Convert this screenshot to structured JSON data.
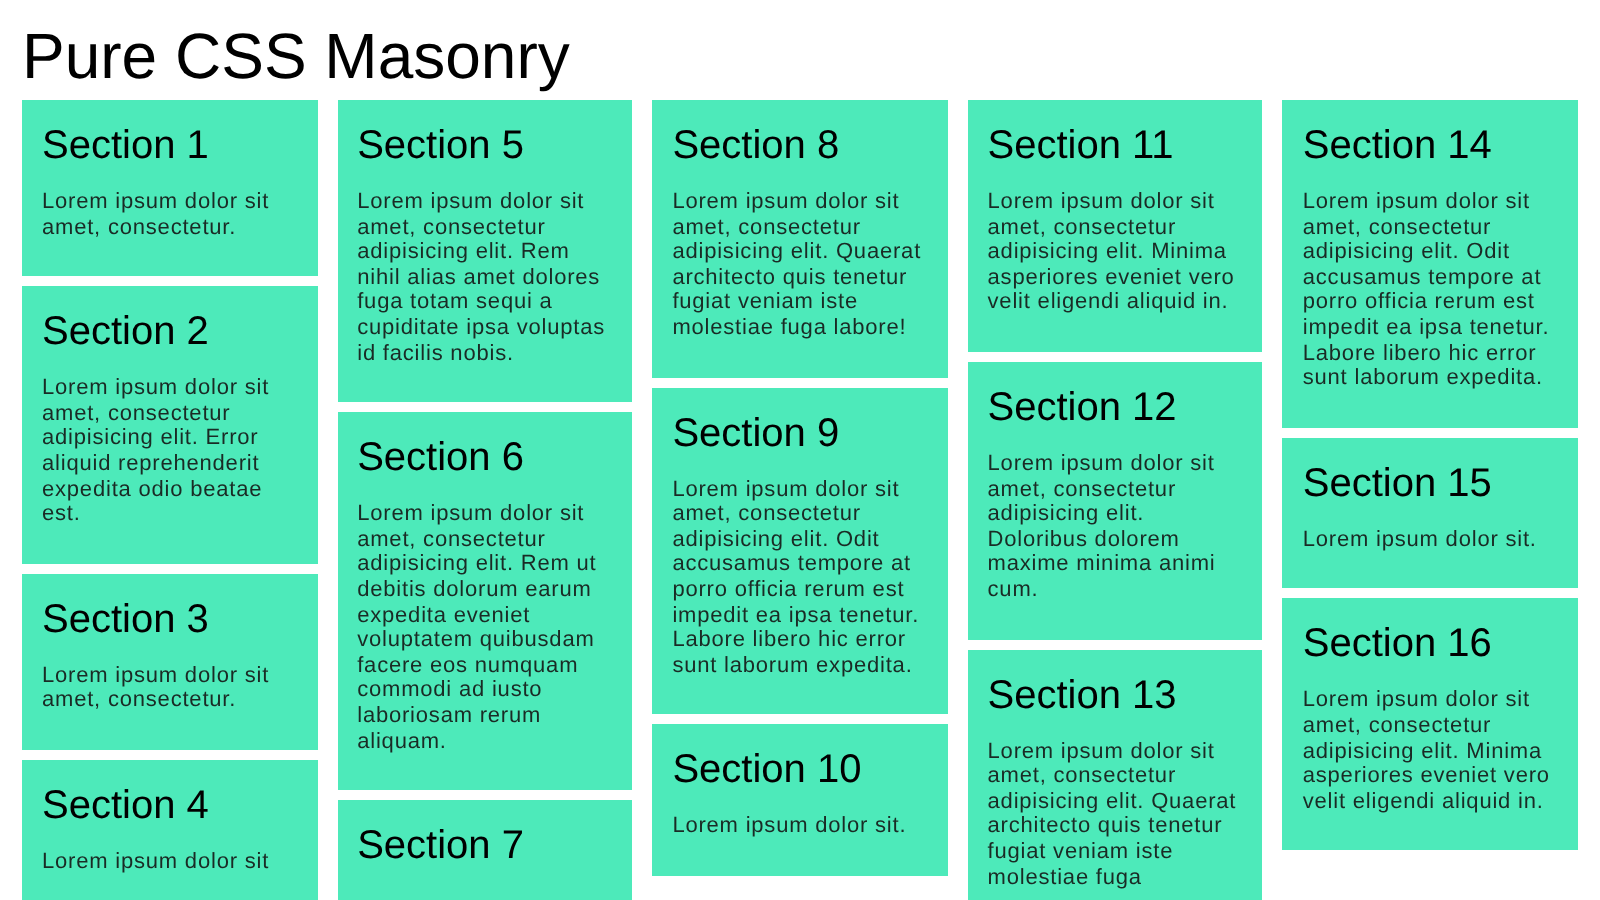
{
  "title": "Pure CSS Masonry",
  "columns": [
    {
      "sections": [
        {
          "title": "Section 1",
          "body": "Lorem ipsum dolor sit amet, consectetur."
        },
        {
          "title": "Section 2",
          "body": "Lorem ipsum dolor sit amet, consectetur adipisicing elit. Error aliquid reprehenderit expedita odio beatae est."
        },
        {
          "title": "Section 3",
          "body": "Lorem ipsum dolor sit amet, consectetur."
        },
        {
          "title": "Section 4",
          "body": "Lorem ipsum dolor sit"
        }
      ]
    },
    {
      "sections": [
        {
          "title": "Section 5",
          "body": "Lorem ipsum dolor sit amet, consectetur adipisicing elit. Rem nihil alias amet dolores fuga totam sequi a cupiditate ipsa voluptas id facilis nobis."
        },
        {
          "title": "Section 6",
          "body": "Lorem ipsum dolor sit amet, consectetur adipisicing elit. Rem ut debitis dolorum earum expedita eveniet voluptatem quibusdam facere eos numquam commodi ad iusto laboriosam rerum aliquam."
        },
        {
          "title": "Section 7"
        }
      ]
    },
    {
      "sections": [
        {
          "title": "Section 8",
          "body": "Lorem ipsum dolor sit amet, consectetur adipisicing elit. Quaerat architecto quis tenetur fugiat veniam iste molestiae fuga labore!"
        },
        {
          "title": "Section 9",
          "body": "Lorem ipsum dolor sit amet, consectetur adipisicing elit. Odit accusamus tempore at porro officia rerum est impedit ea ipsa tenetur. Labore libero hic error sunt laborum expedita."
        },
        {
          "title": "Section 10",
          "body": "Lorem ipsum dolor sit."
        }
      ]
    },
    {
      "sections": [
        {
          "title": "Section 11",
          "body": "Lorem ipsum dolor sit amet, consectetur adipisicing elit. Minima asperiores eveniet vero velit eligendi aliquid in."
        },
        {
          "title": "Section 12",
          "body": "Lorem ipsum dolor sit amet, consectetur adipisicing elit. Doloribus dolorem maxime minima animi cum."
        },
        {
          "title": "Section 13",
          "body": "Lorem ipsum dolor sit amet, consectetur adipisicing elit. Quaerat architecto quis tenetur fugiat veniam iste molestiae fuga"
        }
      ]
    },
    {
      "sections": [
        {
          "title": "Section 14",
          "body": "Lorem ipsum dolor sit amet, consectetur adipisicing elit. Odit accusamus tempore at porro officia rerum est impedit ea ipsa tenetur. Labore libero hic error sunt laborum expedita."
        },
        {
          "title": "Section 15",
          "body": "Lorem ipsum dolor sit."
        },
        {
          "title": "Section 16",
          "body": "Lorem ipsum dolor sit amet, consectetur adipisicing elit. Minima asperiores eveniet vero velit eligendi aliquid in."
        }
      ]
    }
  ]
}
